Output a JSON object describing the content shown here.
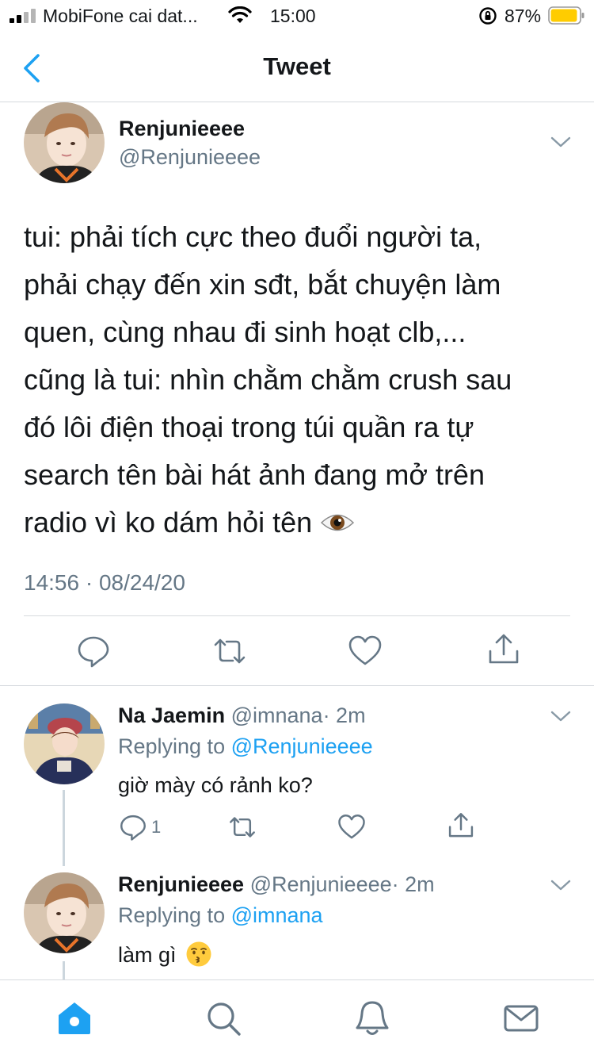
{
  "status_bar": {
    "carrier": "MobiFone cai dat...",
    "time": "15:00",
    "battery": "87%"
  },
  "nav": {
    "title": "Tweet"
  },
  "main_tweet": {
    "name": "Renjunieeee",
    "handle": "@Renjunieeee",
    "text_lines": [
      "tui: phải tích cực theo đuổi người ta,",
      "phải chạy đến xin sđt, bắt chuyện làm",
      "quen, cùng nhau đi sinh hoạt clb,...",
      "cũng là tui: nhìn chằm chằm crush sau",
      "đó lôi điện thoại trong túi quần ra tự",
      "search tên bài hát ảnh đang mở trên",
      "radio vì ko dám hỏi tên"
    ],
    "emoji": "eye-emoji",
    "timestamp": "14:56 · 08/24/20"
  },
  "replies": [
    {
      "name": "Na Jaemin",
      "handle": "@imnana",
      "age": "· 2m",
      "replying_prefix": "Replying to",
      "replying_to": "@Renjunieeee",
      "text": "giờ mày có rảnh ko?",
      "reply_count": "1"
    },
    {
      "name": "Renjunieeee",
      "handle": "@Renjunieeee",
      "age": "· 2m",
      "replying_prefix": "Replying to",
      "replying_to": "@imnana",
      "text": "làm gì",
      "emoji": "kissing-emoji"
    }
  ],
  "colors": {
    "accent": "#1da1f2",
    "secondary_text": "#657786",
    "divider": "#d6dade",
    "battery": "#ffcc00"
  }
}
